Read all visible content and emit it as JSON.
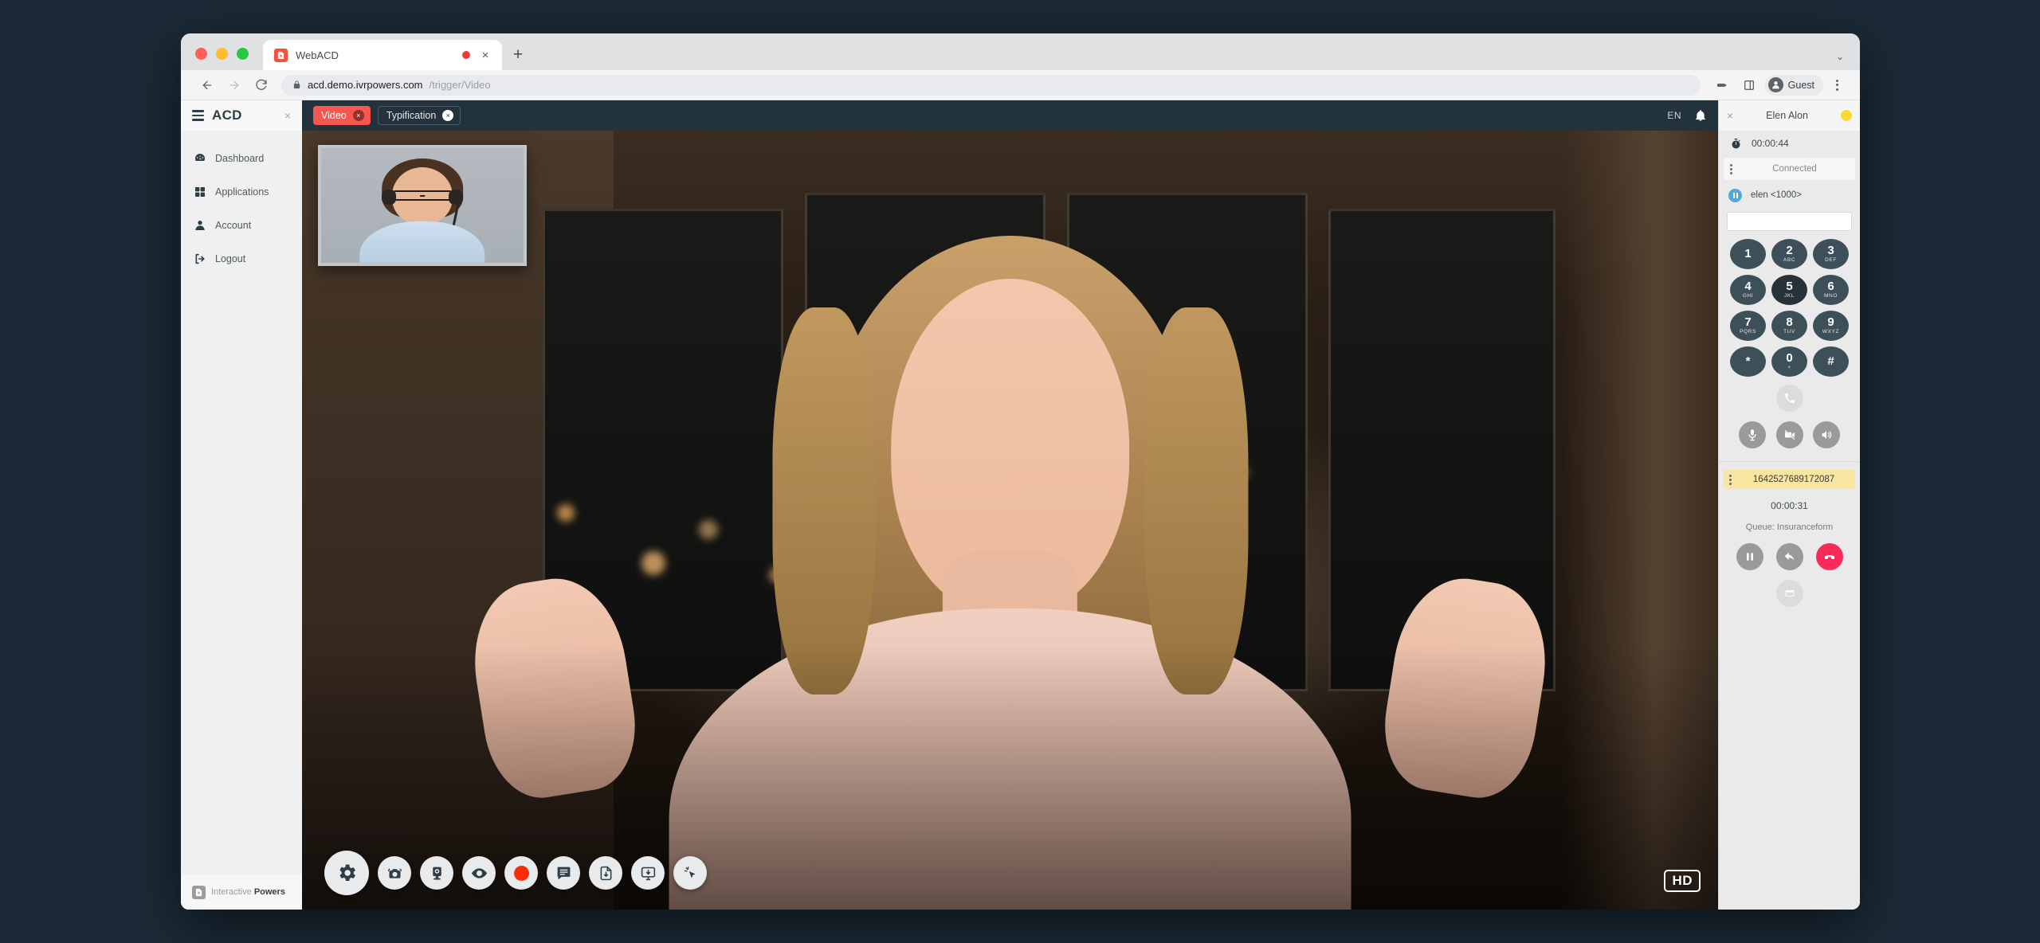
{
  "browser": {
    "tab": {
      "title": "WebACD",
      "favicon_icon": "file-play-icon",
      "recording_icon": "record-dot-icon",
      "close_label": "×"
    },
    "new_tab_label": "+",
    "tabstrip_caret": "⌄",
    "nav": {
      "back_icon": "arrow-left-icon",
      "forward_icon": "arrow-right-icon",
      "reload_icon": "reload-icon"
    },
    "omnibox": {
      "lock_icon": "lock-icon",
      "host": "acd.demo.ivrpowers.com",
      "path": "/trigger/Video"
    },
    "toolbar_right": {
      "extension_icon": "extension-icon",
      "split_icon": "split-view-icon",
      "profile_label": "Guest",
      "menu_icon": "kebab-menu-icon"
    }
  },
  "sidebar": {
    "menu_icon": "hamburger-icon",
    "brand": "ACD",
    "close_label": "×",
    "items": [
      {
        "label": "Dashboard",
        "icon": "dashboard-icon"
      },
      {
        "label": "Applications",
        "icon": "grid-icon"
      },
      {
        "label": "Account",
        "icon": "user-icon"
      },
      {
        "label": "Logout",
        "icon": "logout-icon"
      }
    ],
    "footer": {
      "prefix": "Interactive ",
      "brand": "Powers",
      "logo_icon": "ivr-powers-logo-icon"
    }
  },
  "topbar": {
    "tabs": [
      {
        "label": "Video",
        "state": "active",
        "close_label": "×"
      },
      {
        "label": "Typification",
        "state": "idle",
        "close_label": "×"
      }
    ],
    "language": "EN",
    "bell_icon": "bell-icon"
  },
  "video": {
    "pip_label": "agent-self-view",
    "hd_badge": "HD",
    "toolbar": [
      {
        "name": "settings-button",
        "icon": "gear-icon",
        "size": "big"
      },
      {
        "name": "switch-camera-button",
        "icon": "camera-switch-icon"
      },
      {
        "name": "camera-button",
        "icon": "camera-icon"
      },
      {
        "name": "visibility-button",
        "icon": "eye-icon"
      },
      {
        "name": "record-button",
        "icon": "record-dot-icon"
      },
      {
        "name": "chat-button",
        "icon": "chat-icon"
      },
      {
        "name": "file-download-button",
        "icon": "file-download-icon"
      },
      {
        "name": "screen-share-button",
        "icon": "screen-share-icon"
      },
      {
        "name": "cobrowse-button",
        "icon": "cursor-click-icon"
      }
    ]
  },
  "rightpanel": {
    "close_label": "×",
    "agent_name": "Elen Alon",
    "agent_status_color": "#fdd835",
    "timer_icon": "stopwatch-icon",
    "timer": "00:00:44",
    "connection_status": "Connected",
    "extension_label": "elen <1000>",
    "dial_input_value": "",
    "dial_input_placeholder": "",
    "dialpad": [
      {
        "num": "1",
        "sub": ""
      },
      {
        "num": "2",
        "sub": "ABC"
      },
      {
        "num": "3",
        "sub": "DEF"
      },
      {
        "num": "4",
        "sub": "GHI"
      },
      {
        "num": "5",
        "sub": "JKL"
      },
      {
        "num": "6",
        "sub": "MNO"
      },
      {
        "num": "7",
        "sub": "PQRS"
      },
      {
        "num": "8",
        "sub": "TUV"
      },
      {
        "num": "9",
        "sub": "WXYZ"
      },
      {
        "num": "*",
        "sub": ""
      },
      {
        "num": "0",
        "sub": "+"
      },
      {
        "num": "#",
        "sub": ""
      }
    ],
    "call_button_icon": "phone-icon",
    "media_buttons": [
      {
        "name": "mute-microphone-button",
        "icon": "microphone-icon"
      },
      {
        "name": "disable-video-button",
        "icon": "video-off-icon"
      },
      {
        "name": "speaker-button",
        "icon": "speaker-icon"
      }
    ],
    "session": {
      "id": "1642527689172087",
      "timer": "00:00:31",
      "queue": "Queue: Insuranceform",
      "controls": [
        {
          "name": "hold-call-button",
          "icon": "pause-icon",
          "style": "grey"
        },
        {
          "name": "transfer-call-button",
          "icon": "reply-arrow-icon",
          "style": "grey"
        },
        {
          "name": "hangup-call-button",
          "icon": "hangup-icon",
          "style": "red"
        }
      ],
      "secondary_control": {
        "name": "conference-button",
        "icon": "window-icon",
        "style": "pale"
      }
    }
  },
  "colors": {
    "accent_red": "#f7574f",
    "topbar_dark": "#23333d",
    "hangup_red": "#f72a5a",
    "session_yellow": "#fae6a0",
    "dial_key": "#3d4f58"
  }
}
